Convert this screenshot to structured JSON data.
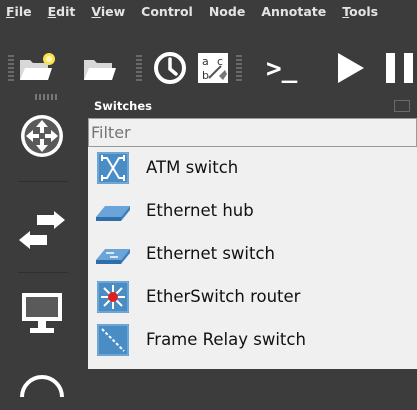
{
  "menubar": {
    "items": [
      {
        "mnemonic": "F",
        "rest": "ile"
      },
      {
        "mnemonic": "E",
        "rest": "dit"
      },
      {
        "mnemonic": "V",
        "rest": "iew"
      },
      {
        "mnemonic": "",
        "rest": "Control"
      },
      {
        "mnemonic": "",
        "rest": "Node"
      },
      {
        "mnemonic": "",
        "rest": "Annotate"
      },
      {
        "mnemonic": "T",
        "rest": "ools"
      }
    ]
  },
  "toolbar": {
    "icons": [
      "new-project-icon",
      "open-project-icon",
      "snapshot-clock-icon",
      "show-interface-labels-icon",
      "console-icon",
      "start-icon",
      "pause-icon"
    ],
    "label_icon_text": [
      "a",
      "c",
      "b"
    ],
    "console_text": ">_"
  },
  "left_dock": {
    "buttons": [
      "routers-icon",
      "switches-icon",
      "end-devices-icon",
      "security-devices-icon"
    ]
  },
  "panel": {
    "title": "Switches",
    "filter_placeholder": "Filter",
    "items": [
      {
        "label": "ATM switch",
        "icon": "atm-switch-icon"
      },
      {
        "label": "Ethernet hub",
        "icon": "ethernet-hub-icon"
      },
      {
        "label": "Ethernet switch",
        "icon": "ethernet-switch-icon"
      },
      {
        "label": "EtherSwitch router",
        "icon": "etherswitch-router-icon"
      },
      {
        "label": "Frame Relay switch",
        "icon": "frame-relay-switch-icon"
      }
    ]
  },
  "colors": {
    "background": "#3c3c3c",
    "list_background": "#f0f0f0",
    "icon_blue": "#4a8cc4",
    "switch_red": "#e02020"
  }
}
